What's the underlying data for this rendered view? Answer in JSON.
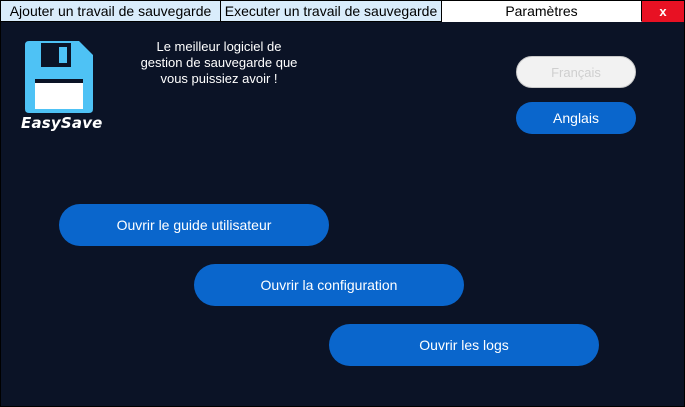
{
  "tabs": [
    {
      "label": "Ajouter un travail de sauvegarde"
    },
    {
      "label": "Executer un travail de sauvegarde"
    },
    {
      "label": "Paramètres"
    }
  ],
  "window": {
    "close_label": "x"
  },
  "brand": {
    "name": "EasySave"
  },
  "tagline": {
    "line1": "Le meilleur logiciel de",
    "line2": "gestion de sauvegarde que",
    "line3": "vous puissiez avoir !"
  },
  "language": {
    "french": "Français",
    "english": "Anglais"
  },
  "actions": {
    "user_guide": "Ouvrir le guide utilisateur",
    "configuration": "Ouvrir la configuration",
    "logs": "Ouvrir les logs"
  },
  "colors": {
    "background": "#0b1326",
    "accent": "#0a66cc",
    "close": "#e81123",
    "logo": "#4ec2f5"
  }
}
